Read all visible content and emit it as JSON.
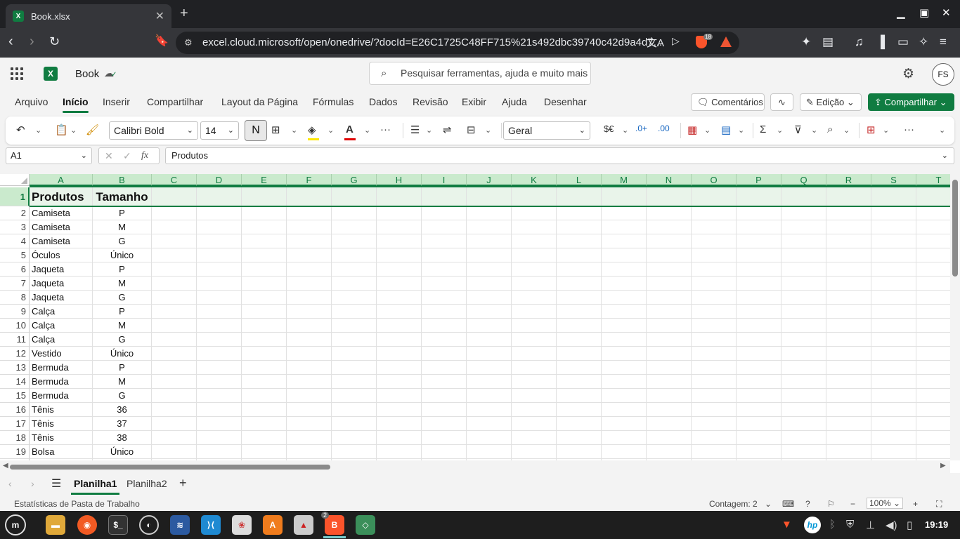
{
  "browser": {
    "tab_title": "Book.xlsx",
    "url": "excel.cloud.microsoft/open/onedrive/?docId=E26C1725C48FF715%21s492dbc39740c42d9a4d7...",
    "shield_badge": "18"
  },
  "app": {
    "doc_name": "Book",
    "search_placeholder": "Pesquisar ferramentas, ajuda e muito mais (Alt + Q)",
    "avatar_initials": "FS",
    "accent_color": "#107c41"
  },
  "menu": {
    "items": [
      "Arquivo",
      "Início",
      "Inserir",
      "Compartilhar",
      "Layout da Página",
      "Fórmulas",
      "Dados",
      "Revisão",
      "Exibir",
      "Ajuda",
      "Desenhar"
    ],
    "active": "Início",
    "comments_label": "Comentários",
    "edit_label": "Edição",
    "share_label": "Compartilhar"
  },
  "ribbon": {
    "font_name": "Calibri Bold",
    "font_size": "14",
    "bold_label": "N",
    "number_format": "Geral",
    "currency_label": "$€"
  },
  "formula_bar": {
    "name_box": "A1",
    "fx_label": "fx",
    "content": "Produtos"
  },
  "sheet": {
    "columns": [
      "A",
      "B",
      "C",
      "D",
      "E",
      "F",
      "G",
      "H",
      "I",
      "J",
      "K",
      "L",
      "M",
      "N",
      "O",
      "P",
      "Q",
      "R",
      "S",
      "T"
    ],
    "rows": [
      {
        "n": "1",
        "a": "Produtos",
        "b": "Tamanho"
      },
      {
        "n": "2",
        "a": "Camiseta",
        "b": "P"
      },
      {
        "n": "3",
        "a": "Camiseta",
        "b": "M"
      },
      {
        "n": "4",
        "a": "Camiseta",
        "b": "G"
      },
      {
        "n": "5",
        "a": "Óculos",
        "b": "Único"
      },
      {
        "n": "6",
        "a": "Jaqueta",
        "b": "P"
      },
      {
        "n": "7",
        "a": "Jaqueta",
        "b": "M"
      },
      {
        "n": "8",
        "a": "Jaqueta",
        "b": "G"
      },
      {
        "n": "9",
        "a": "Calça",
        "b": "P"
      },
      {
        "n": "10",
        "a": "Calça",
        "b": "M"
      },
      {
        "n": "11",
        "a": "Calça",
        "b": "G"
      },
      {
        "n": "12",
        "a": "Vestido",
        "b": "Único"
      },
      {
        "n": "13",
        "a": "Bermuda",
        "b": "P"
      },
      {
        "n": "14",
        "a": "Bermuda",
        "b": "M"
      },
      {
        "n": "15",
        "a": "Bermuda",
        "b": "G"
      },
      {
        "n": "16",
        "a": "Tênis",
        "b": "36"
      },
      {
        "n": "17",
        "a": "Tênis",
        "b": "37"
      },
      {
        "n": "18",
        "a": "Tênis",
        "b": "38"
      },
      {
        "n": "19",
        "a": "Bolsa",
        "b": "Único"
      }
    ]
  },
  "sheet_tabs": {
    "tabs": [
      "Planilha1",
      "Planilha2"
    ],
    "active": "Planilha1"
  },
  "status": {
    "workbook_stats": "Estatísticas de Pasta de Trabalho",
    "count": "Contagem: 2",
    "zoom": "100%"
  },
  "taskbar": {
    "time": "19:19",
    "brave_badge": "2"
  }
}
